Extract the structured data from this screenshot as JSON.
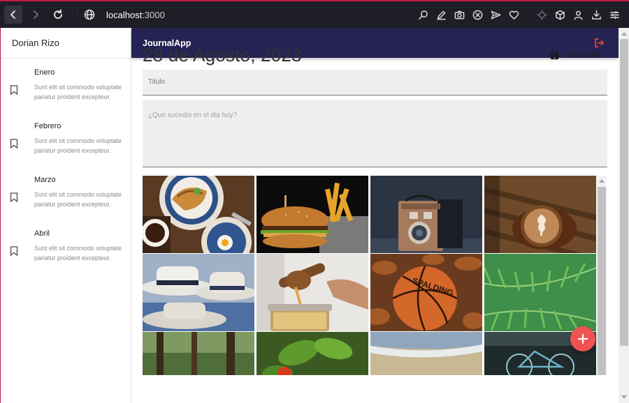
{
  "browser": {
    "url_host": "localhost",
    "url_port": ":3000"
  },
  "sidebar": {
    "user_name": "Dorian Rizo",
    "entries": [
      {
        "title": "Enero",
        "body": "Sunt elit sit commodo voluptate pariatur proident excepteur."
      },
      {
        "title": "Febrero",
        "body": "Sunt elit sit commodo voluptate pariatur proident excepteur."
      },
      {
        "title": "Marzo",
        "body": "Sunt elit sit commodo voluptate pariatur proident excepteur."
      },
      {
        "title": "Abril",
        "body": "Sunt elit sit commodo voluptate pariatur proident excepteur."
      }
    ]
  },
  "appbar": {
    "title": "JournalApp"
  },
  "note": {
    "date": "28 de Agosto, 2023",
    "save_label": "GUARDAR",
    "title_placeholder": "Titulo",
    "body_placeholder": "¿Que sucedio en el dia hoy?"
  },
  "gallery": {
    "photos": [
      "croissant-breakfast",
      "burger-and-fries",
      "vintage-box-camera",
      "latte-art-coffee",
      "straw-hats",
      "honey-dipper-jar",
      "basketball-leaves",
      "green-fern",
      "forest-trees",
      "basil-leaves",
      "beach-shore",
      "bicycle-street"
    ]
  },
  "colors": {
    "appbar": "#262254",
    "fab": "#ef5350",
    "logout_icon": "#f44336",
    "browser_accent": "#c21a45"
  }
}
